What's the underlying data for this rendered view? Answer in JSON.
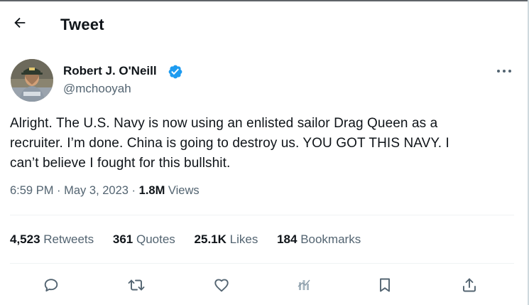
{
  "header": {
    "title": "Tweet",
    "back_icon": "arrow-left-icon"
  },
  "tweet": {
    "author_name": "Robert J. O'Neill",
    "handle": "@mchooyah",
    "verified": true,
    "verified_color": "#1d9bf0",
    "text": "Alright. The U.S. Navy is now using an enlisted sailor Drag Queen as a\nrecruiter. I’m done. China is going to destroy us. YOU GOT THIS NAVY. I\ncan’t believe I fought for this bullshit.",
    "time": "6:59 PM",
    "date": "May 3, 2023",
    "sep": "·",
    "views_count": "1.8M",
    "views_label": "Views"
  },
  "stats": [
    {
      "count": "4,523",
      "label": "Retweets"
    },
    {
      "count": "361",
      "label": "Quotes"
    },
    {
      "count": "25.1K",
      "label": "Likes"
    },
    {
      "count": "184",
      "label": "Bookmarks"
    }
  ],
  "actions": [
    "reply-icon",
    "retweet-icon",
    "like-icon",
    "analytics-icon",
    "bookmark-icon",
    "share-icon"
  ],
  "colors": {
    "text": "#0f1419",
    "secondary": "#536471",
    "divider": "#eff3f4",
    "brand": "#1d9bf0"
  }
}
